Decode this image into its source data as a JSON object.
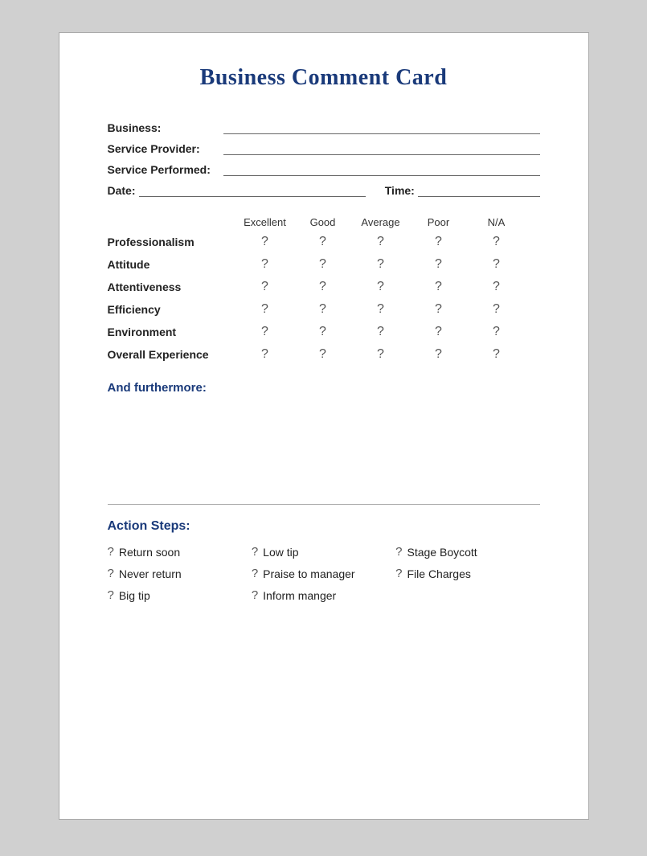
{
  "title": "Business Comment Card",
  "form": {
    "business_label": "Business:",
    "service_provider_label": "Service Provider:",
    "service_performed_label": "Service Performed:",
    "date_label": "Date:",
    "time_label": "Time:"
  },
  "ratings": {
    "headers": [
      "Excellent",
      "Good",
      "Average",
      "Poor",
      "N/A"
    ],
    "rows": [
      {
        "label": "Professionalism"
      },
      {
        "label": "Attitude"
      },
      {
        "label": "Attentiveness"
      },
      {
        "label": "Efficiency"
      },
      {
        "label": "Environment"
      },
      {
        "label": "Overall Experience"
      }
    ],
    "placeholder": "?"
  },
  "furthermore": {
    "label": "And furthermore:"
  },
  "action_steps": {
    "title": "Action Steps:",
    "items": [
      {
        "col": 0,
        "text": "Return soon"
      },
      {
        "col": 1,
        "text": "Low tip"
      },
      {
        "col": 2,
        "text": "Stage Boycott"
      },
      {
        "col": 0,
        "text": "Never return"
      },
      {
        "col": 1,
        "text": "Praise to manager"
      },
      {
        "col": 2,
        "text": "File Charges"
      },
      {
        "col": 0,
        "text": "Big tip"
      },
      {
        "col": 1,
        "text": "Inform manger"
      }
    ]
  }
}
